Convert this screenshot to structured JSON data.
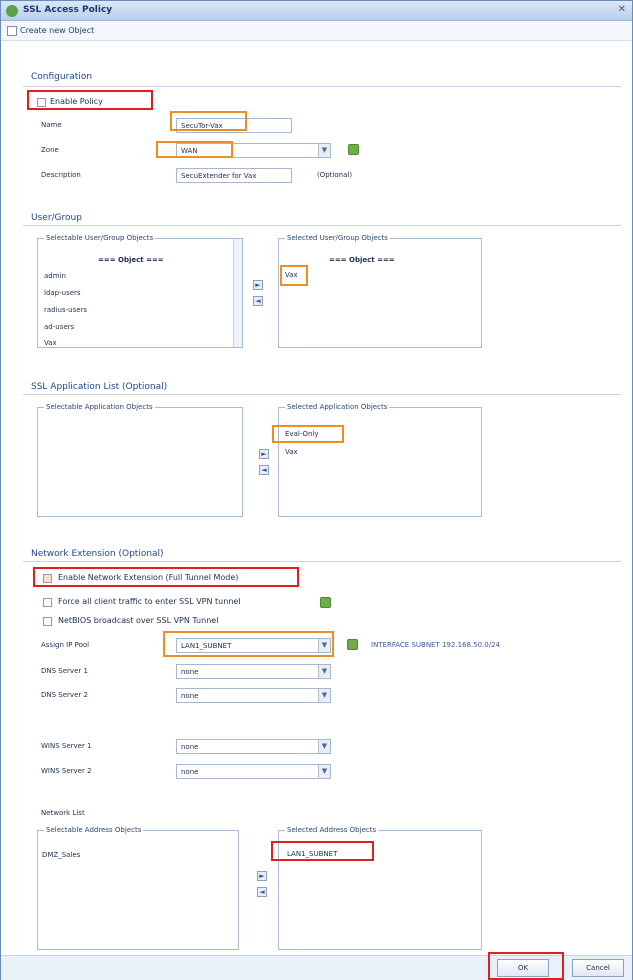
{
  "window": {
    "title": "SSL Access Policy",
    "toolbar_label": "Create new Object"
  },
  "configuration": {
    "section": "Configuration",
    "enable_policy": "Enable Policy",
    "name_label": "Name",
    "name_value": "SecuTor-Vax",
    "zone_label": "Zone",
    "zone_value": "WAN",
    "description_label": "Description",
    "description_value": "SecuExtender for Vax",
    "optional": "(Optional)"
  },
  "user_group": {
    "section": "User/Group",
    "selectable_header": "Selectable User/Group Objects",
    "selected_header": "Selected User/Group Objects",
    "object_marker": "=== Object ===",
    "selectable_items": [
      "admin",
      "ldap-users",
      "radius-users",
      "ad-users",
      "Vax"
    ],
    "selected_items": [
      "Vax"
    ]
  },
  "ssl_apps": {
    "section": "SSL Application List (Optional)",
    "selectable_header": "Selectable Application Objects",
    "selected_header": "Selected Application Objects",
    "selected_items": [
      "Eval-Only",
      "Vax"
    ]
  },
  "network_extension": {
    "section": "Network Extension (Optional)",
    "enable": "Enable Network Extension (Full Tunnel Mode)",
    "force_traffic": "Force all client traffic to enter SSL VPN tunnel",
    "netbios": "NetBIOS broadcast over SSL VPN Tunnel",
    "assign_ip_label": "Assign IP Pool",
    "assign_ip_value": "LAN1_SUBNET",
    "assign_ip_note": "INTERFACE SUBNET 192.168.50.0/24",
    "dns1_label": "DNS Server 1",
    "dns1_value": "none",
    "dns2_label": "DNS Server 2",
    "dns2_value": "none",
    "wins1_label": "WINS Server 1",
    "wins1_value": "none",
    "wins2_label": "WINS Server 2",
    "wins2_value": "none",
    "network_list": "Network List",
    "selectable_header": "Selectable Address Objects",
    "selected_header": "Selected Address Objects",
    "selectable_items": [
      "DMZ_Sales"
    ],
    "selected_items": [
      "LAN1_SUBNET"
    ]
  },
  "buttons": {
    "ok": "OK",
    "cancel": "Cancel",
    "move_right": "►",
    "move_left": "◄"
  },
  "colors": {
    "highlight_red": "#e01f1f",
    "highlight_orange": "#f08c21",
    "accent": "#20498b"
  }
}
